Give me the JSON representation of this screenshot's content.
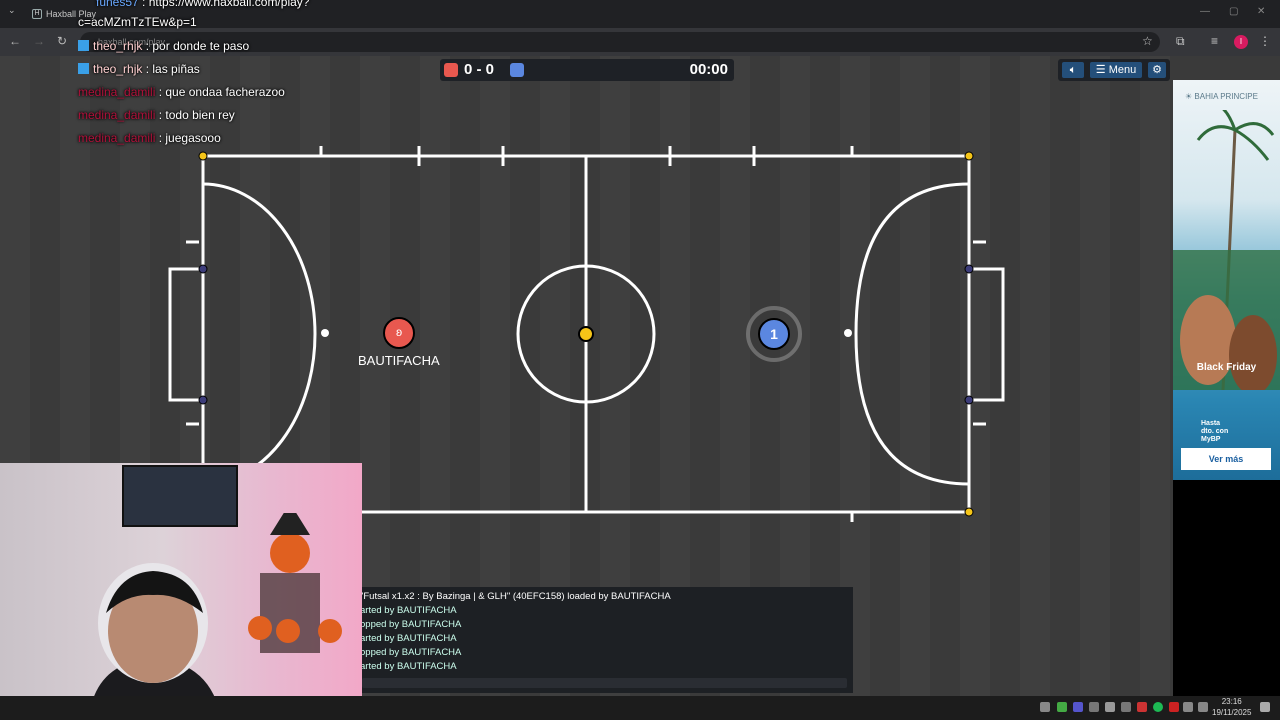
{
  "browser": {
    "tab_title": "Haxball Play",
    "tab_favicon": "H",
    "url_text": "haxball.com/play",
    "profile_initial": "I"
  },
  "chat": [
    {
      "name": "funes57",
      "text": ": https://www.haxball.com/play?"
    },
    {
      "name": "",
      "text": "c=acMZmTzTEw&p=1"
    },
    {
      "name": "theo_rhjk",
      "text": ": por donde te paso"
    },
    {
      "name": "theo_rhjk",
      "text": ": las piñas"
    },
    {
      "name": "medina_damili",
      "text": ": que ondaa facherazoo"
    },
    {
      "name": "medina_damili",
      "text": ": todo bien rey"
    },
    {
      "name": "medina_damili",
      "text": ": juegasooo"
    }
  ],
  "scoreboard": {
    "red_color": "#e8584f",
    "blue_color": "#5b87e0",
    "score": "0 - 0",
    "timer": "00:00"
  },
  "controls": {
    "sound_icon": "speaker-icon",
    "menu_label": "Menu",
    "settings_icon": "gear-icon"
  },
  "players": {
    "red_name": "BAUTIFACHA",
    "red_avatar": "ʚ",
    "blue_number": "1"
  },
  "game_log": [
    "\"Futsal x1.x2 : By Bazinga | & GLH\" (40EFC158) loaded by BAUTIFACHA",
    "arted by BAUTIFACHA",
    "opped by BAUTIFACHA",
    "arted by BAUTIFACHA",
    "opped by BAUTIFACHA",
    "arted by BAUTIFACHA"
  ],
  "ad": {
    "brand": "BAHIA PRINCIPE",
    "headline": "Black  Friday",
    "line1": "Hasta",
    "line2": "dto. con",
    "line3": "MyBP",
    "cta": "Ver más"
  },
  "taskbar": {
    "time": "23:16",
    "date": "19/11/2025"
  },
  "colors": {
    "field_line": "#ffffff",
    "ball": "#f5c518",
    "red_team": "#e8584f",
    "blue_team": "#5b87e0"
  }
}
